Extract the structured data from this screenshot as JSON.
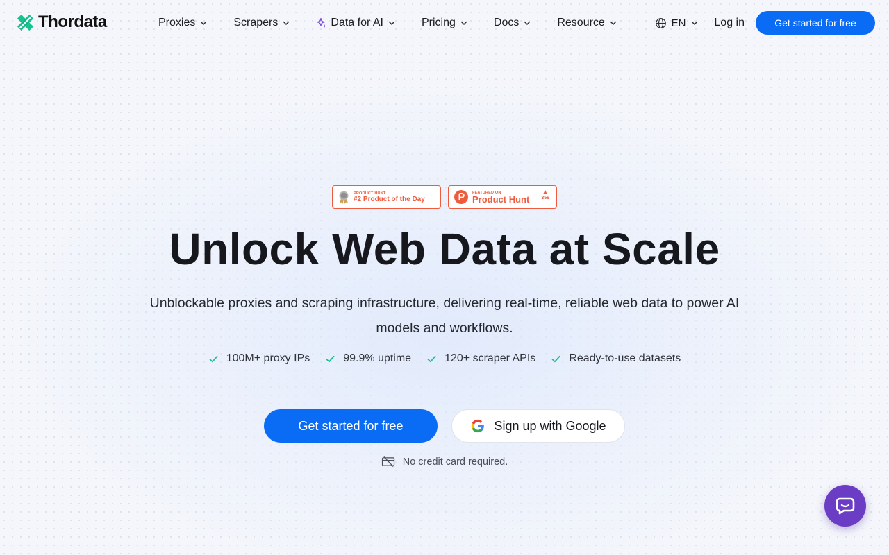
{
  "brand": {
    "name": "Thordata",
    "accent": "#0a6cf5",
    "logo_color": "#14c38e"
  },
  "nav": {
    "items": [
      {
        "label": "Proxies",
        "has_dropdown": true
      },
      {
        "label": "Scrapers",
        "has_dropdown": true
      },
      {
        "label": "Data for AI",
        "has_dropdown": true,
        "icon": "sparkle-icon"
      },
      {
        "label": "Pricing",
        "has_dropdown": true
      },
      {
        "label": "Docs",
        "has_dropdown": true
      },
      {
        "label": "Resource",
        "has_dropdown": true
      }
    ],
    "language": "EN",
    "login": "Log in",
    "cta": "Get started for free"
  },
  "badges": [
    {
      "kicker": "PRODUCT HUNT",
      "text": "#2 Product of the Day",
      "icon": "medal-icon"
    },
    {
      "kicker": "FEATURED ON",
      "text": "Product Hunt",
      "icon": "product-hunt-icon",
      "votes": "356"
    }
  ],
  "hero": {
    "title": "Unlock Web Data at Scale",
    "subtitle": "Unblockable proxies and scraping infrastructure, delivering real-time, reliable web data to power AI models and workflows.",
    "features": [
      "100M+ proxy IPs",
      "99.9% uptime",
      "120+ scraper APIs",
      "Ready-to-use datasets"
    ],
    "cta_primary": "Get started for free",
    "cta_google": "Sign up with Google",
    "note": "No credit card required."
  },
  "chat": {
    "icon": "chat-bubble-icon",
    "color": "#6b3dc4"
  }
}
